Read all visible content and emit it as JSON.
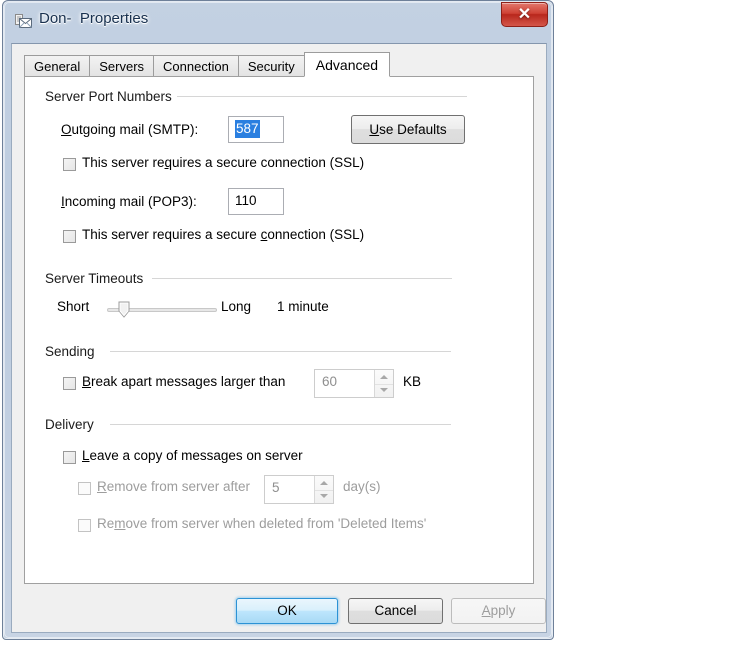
{
  "window": {
    "title": "Don-  Properties",
    "icon": "mail-account-icon",
    "close_label": "✕",
    "frame_color": "#bccbdf",
    "close_color": "#c0392b"
  },
  "tabs": [
    {
      "label": "General",
      "selected": false
    },
    {
      "label": "Servers",
      "selected": false
    },
    {
      "label": "Connection",
      "selected": false
    },
    {
      "label": "Security",
      "selected": false
    },
    {
      "label": "Advanced",
      "selected": true
    }
  ],
  "groups": {
    "ports": {
      "label": "Server Port Numbers"
    },
    "timeouts": {
      "label": "Server Timeouts"
    },
    "sending": {
      "label": "Sending"
    },
    "delivery": {
      "label": "Delivery"
    }
  },
  "ports": {
    "outgoing": {
      "label_pre": "",
      "label_accel": "O",
      "label_post": "utgoing mail (SMTP):",
      "value": "587",
      "selected": true
    },
    "incoming": {
      "label_accel": "I",
      "label_post": "ncoming mail (POP3):",
      "value": "110",
      "selected": false
    },
    "use_defaults": {
      "accel": "U",
      "label_post": "se Defaults"
    },
    "ssl_outgoing": {
      "pre": "This server re",
      "accel": "q",
      "post": "uires a secure connection (SSL)",
      "checked": false
    },
    "ssl_incoming": {
      "pre": "This server requires a secure ",
      "accel": "c",
      "post": "onnection (SSL)",
      "checked": false
    }
  },
  "timeouts": {
    "short_label": "Short",
    "long_label": "Long",
    "value_label": "1 minute",
    "position_percent": 12
  },
  "sending": {
    "break_apart": {
      "pre": "",
      "accel": "B",
      "post": "reak apart messages larger than",
      "checked": false,
      "enabled": true
    },
    "size_value": "60",
    "unit_label": "KB"
  },
  "delivery": {
    "leave_copy": {
      "accel": "L",
      "post": "eave a copy of messages on server",
      "checked": false,
      "enabled": true
    },
    "remove_after": {
      "accel": "R",
      "post": "emove from server after",
      "checked": false,
      "enabled": false
    },
    "days_value": "5",
    "days_unit": "day(s)",
    "remove_deleted": {
      "pre": "Re",
      "accel": "m",
      "post": "ove from server when deleted from 'Deleted Items'",
      "checked": false,
      "enabled": false
    }
  },
  "footer": {
    "ok": "OK",
    "cancel": "Cancel",
    "apply_accel": "A",
    "apply_post": "pply",
    "apply_enabled": false
  }
}
